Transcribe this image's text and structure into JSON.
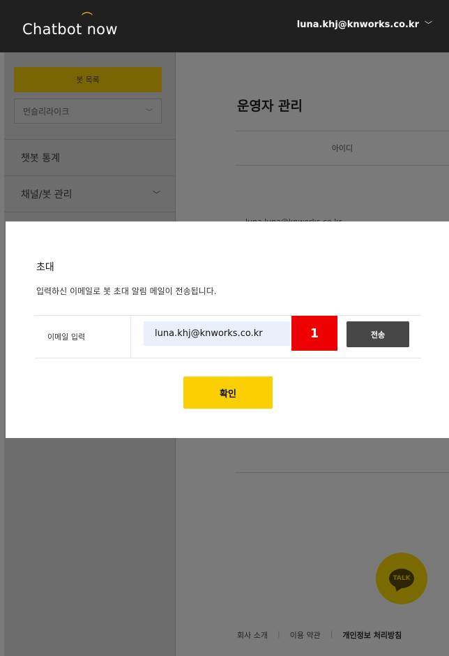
{
  "header": {
    "logo_text": "Chatbot now",
    "user_email": "luna.khj@knworks.co.kr",
    "dropdown_icon": "chevron-down-icon"
  },
  "sidebar": {
    "bot_list_label": "봇 목록",
    "selected_bot": "먼슬리라이크",
    "menu": [
      {
        "label": "챗봇 통계"
      },
      {
        "label": "채널/봇 관리"
      }
    ]
  },
  "main": {
    "title": "운영자 관리",
    "table_header": "아이디",
    "partial_row_text": "luna.luna@knworks.co.kr"
  },
  "modal": {
    "title": "초대",
    "description": "입력하신 이메일로 봇 초대 알림 메일이 전송됩니다.",
    "email_label": "이메일 입력",
    "email_value": "luna.khj@knworks.co.kr",
    "badge": "1",
    "send_label": "전송",
    "confirm_label": "확인"
  },
  "talk_button": {
    "label": "TALK"
  },
  "footer": {
    "links": [
      "회사 소개",
      "이용 약관",
      "개인정보 처리방침"
    ]
  },
  "colors": {
    "accent": "#fccf00",
    "header_bg": "#202020",
    "badge": "#ee0000",
    "send_button": "#474747",
    "input_bg": "#e9f0fc"
  }
}
